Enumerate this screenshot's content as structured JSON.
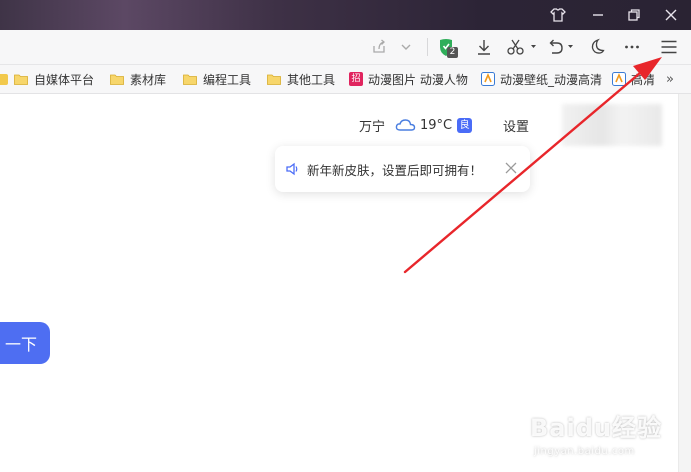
{
  "window": {
    "controls": {
      "skin": "skin-icon",
      "minimize": "minimize-icon",
      "restore": "restore-icon",
      "close": "close-icon"
    }
  },
  "toolbar": {
    "adblock_count": "2",
    "icons": [
      "share-icon",
      "chevron-down-icon",
      "shield-icon",
      "download-icon",
      "scissors-icon",
      "undo-icon",
      "moon-icon",
      "more-icon",
      "menu-icon"
    ]
  },
  "bookmarks": [
    {
      "label": "自媒体平台",
      "type": "folder"
    },
    {
      "label": "素材库",
      "type": "folder"
    },
    {
      "label": "编程工具",
      "type": "folder"
    },
    {
      "label": "其他工具",
      "type": "folder"
    },
    {
      "label": "动漫图片 动漫人物",
      "type": "site",
      "fav_text": "招"
    },
    {
      "label": "动漫壁纸_动漫高清",
      "type": "site"
    },
    {
      "label": "高清",
      "type": "site"
    }
  ],
  "weather": {
    "city": "万宁",
    "temperature": "19°C",
    "air_quality": "良",
    "settings_label": "设置"
  },
  "notice": {
    "text": "新年新皮肤，设置后即可拥有！"
  },
  "search": {
    "button_label": "一下"
  },
  "watermark": {
    "main": "Baidu经验",
    "sub": "jingyan.baidu.com"
  },
  "colors": {
    "accent": "#4e6ef2",
    "arrow": "#e8262b",
    "folder": "#f2c94c"
  }
}
